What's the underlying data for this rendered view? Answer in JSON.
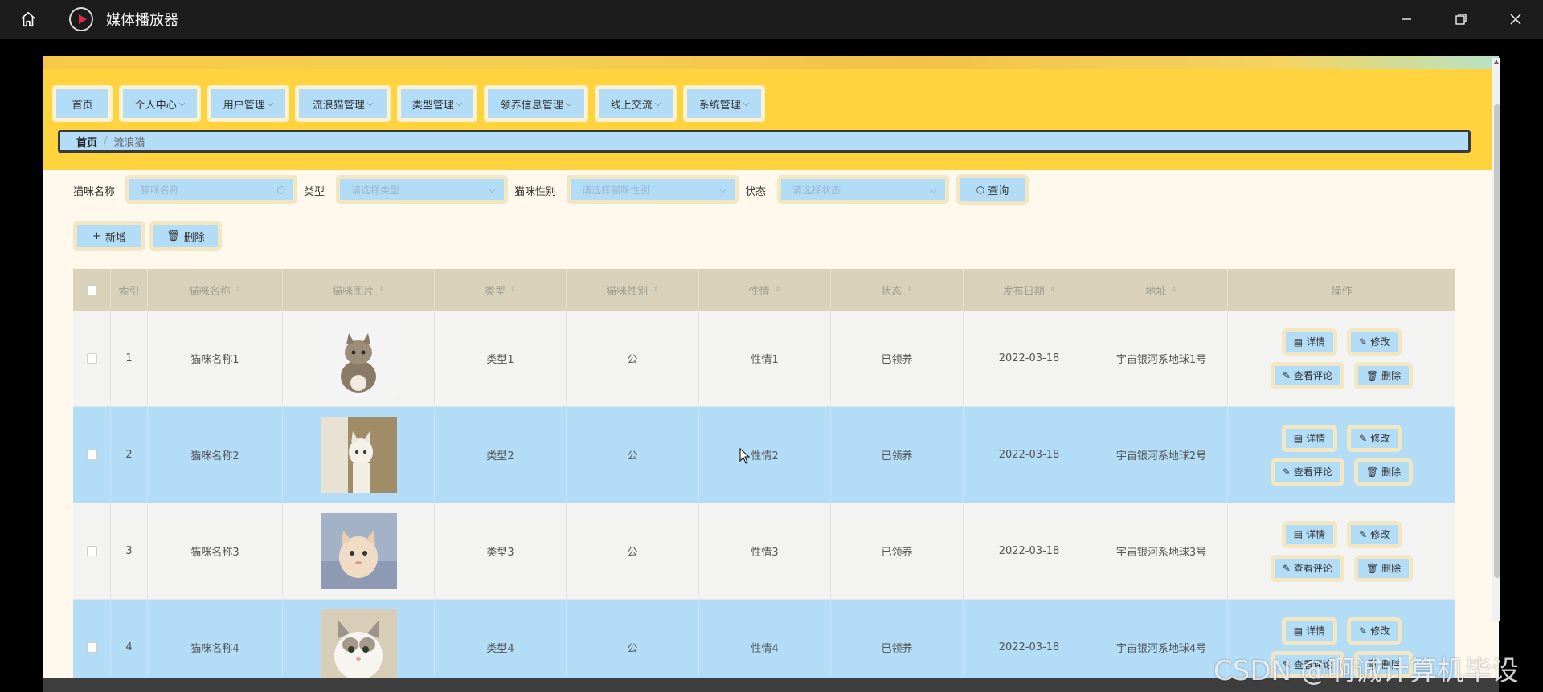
{
  "window": {
    "title": "媒体播放器"
  },
  "nav": [
    {
      "label": "首页",
      "dropdown": false
    },
    {
      "label": "个人中心",
      "dropdown": true
    },
    {
      "label": "用户管理",
      "dropdown": true
    },
    {
      "label": "流浪猫管理",
      "dropdown": true
    },
    {
      "label": "类型管理",
      "dropdown": true
    },
    {
      "label": "领养信息管理",
      "dropdown": true
    },
    {
      "label": "线上交流",
      "dropdown": true
    },
    {
      "label": "系统管理",
      "dropdown": true
    }
  ],
  "breadcrumb": {
    "home": "首页",
    "sep": "/",
    "current": "流浪猫"
  },
  "search": {
    "name_label": "猫咪名称",
    "name_placeholder": "猫咪名称",
    "type_label": "类型",
    "type_placeholder": "请选择类型",
    "gender_label": "猫咪性别",
    "gender_placeholder": "请选择猫咪性别",
    "status_label": "状态",
    "status_placeholder": "请选择状态",
    "query_button": "查询"
  },
  "actions": {
    "add": "新增",
    "delete": "删除"
  },
  "table": {
    "headers": [
      "索引",
      "猫咪名称",
      "猫咪图片",
      "类型",
      "猫咪性别",
      "性情",
      "状态",
      "发布日期",
      "地址",
      "操作"
    ],
    "rows": [
      {
        "index": "1",
        "name": "猫咪名称1",
        "type": "类型1",
        "gender": "公",
        "temper": "性情1",
        "status": "已领养",
        "date": "2022-03-18",
        "address": "宇宙银河系地球1号"
      },
      {
        "index": "2",
        "name": "猫咪名称2",
        "type": "类型2",
        "gender": "公",
        "temper": "性情2",
        "status": "已领养",
        "date": "2022-03-18",
        "address": "宇宙银河系地球2号"
      },
      {
        "index": "3",
        "name": "猫咪名称3",
        "type": "类型3",
        "gender": "公",
        "temper": "性情3",
        "status": "已领养",
        "date": "2022-03-18",
        "address": "宇宙银河系地球3号"
      },
      {
        "index": "4",
        "name": "猫咪名称4",
        "type": "类型4",
        "gender": "公",
        "temper": "性情4",
        "status": "已领养",
        "date": "2022-03-18",
        "address": "宇宙银河系地球4号"
      }
    ],
    "ops": {
      "detail": "详情",
      "edit": "修改",
      "comments": "查看评论",
      "delete": "删除"
    }
  },
  "watermark": "CSDN @啊诚计算机毕设"
}
